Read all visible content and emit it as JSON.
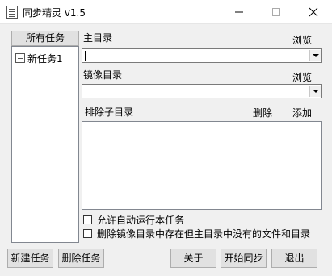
{
  "window": {
    "title": "同步精灵 v1.5"
  },
  "tasks": {
    "header_label": "所有任务",
    "items": [
      {
        "label": "新任务1"
      }
    ]
  },
  "main_dir": {
    "label": "主目录",
    "browse_label": "浏览",
    "value": ""
  },
  "mirror_dir": {
    "label": "镜像目录",
    "browse_label": "浏览",
    "value": ""
  },
  "exclude": {
    "label": "排除子目录",
    "delete_label": "删除",
    "add_label": "添加",
    "items": []
  },
  "options": {
    "auto_run_label": "允许自动运行本任务",
    "delete_extra_label": "删除镜像目录中存在但主目录中没有的文件和目录"
  },
  "buttons": {
    "new_task": "新建任务",
    "delete_task": "删除任务",
    "about": "关于",
    "start_sync": "开始同步",
    "exit": "退出"
  }
}
